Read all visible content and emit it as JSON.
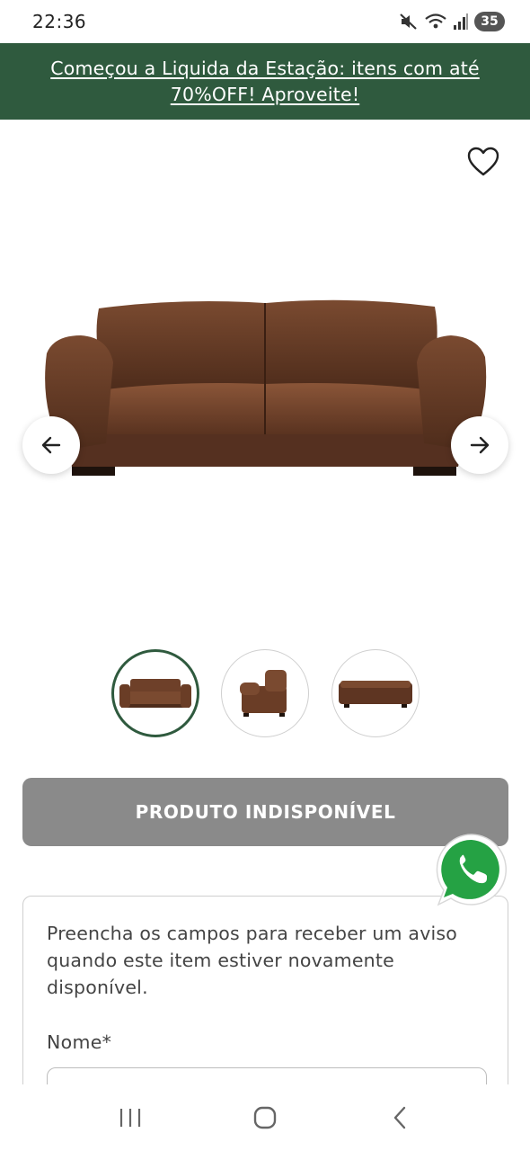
{
  "status_bar": {
    "time": "22:36",
    "battery": "35",
    "icons": [
      "mute-icon",
      "wifi-icon",
      "signal-icon",
      "battery-icon"
    ]
  },
  "promo_banner": {
    "text": "Começou a Liquida da Estação: itens com até 70%OFF! Aproveite!",
    "background": "#2f5a3e"
  },
  "product": {
    "favorite_icon": "heart-outline-icon",
    "image_icon": "sofa-image",
    "prev_icon": "arrow-left-icon",
    "next_icon": "arrow-right-icon",
    "gallery_total": 3,
    "gallery_active_index": 1
  },
  "cta": {
    "unavailable_label": "PRODUTO INDISPONÍVEL",
    "color": "#8a8a8a"
  },
  "notify_form": {
    "description": "Preencha os campos para receber um aviso quando este item estiver novamente disponível.",
    "name_label": "Nome*",
    "name_value": ""
  },
  "whatsapp": {
    "icon": "whatsapp-icon",
    "color": "#25a244"
  },
  "nav_bar": {
    "icons": [
      "recent-apps-icon",
      "home-icon",
      "back-icon"
    ]
  }
}
